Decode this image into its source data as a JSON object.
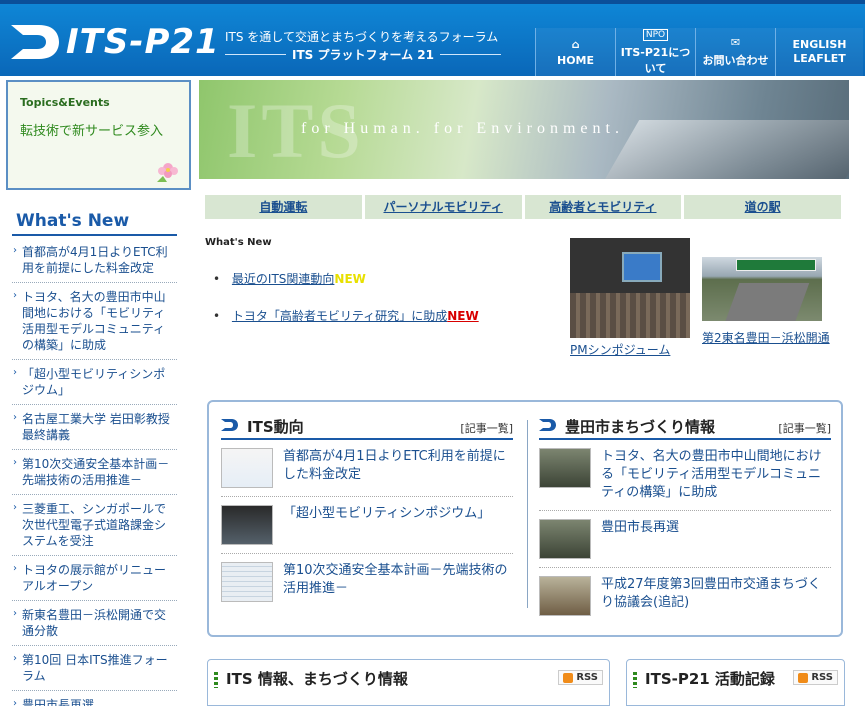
{
  "header": {
    "logo_text": "ITS-P21",
    "tagline1": "ITS を通して交通とまちづくりを考えるフォーラム",
    "tagline2": "ITS プラットフォーム 21",
    "nav": [
      {
        "icon": "home-icon",
        "label": "HOME"
      },
      {
        "icon": "npo-badge",
        "badge": "NPO",
        "label": "ITS-P21について"
      },
      {
        "icon": "mail-icon",
        "label": "お問い合わせ"
      },
      {
        "label_line1": "ENGLISH",
        "label_line2": "LEAFLET"
      }
    ]
  },
  "topics": {
    "title": "Topics&Events",
    "text": "転技術で新サービス参入"
  },
  "whats_new": {
    "title": "What's New",
    "items": [
      "首都高が4月1日よりETC利用を前提にした料金改定",
      "トヨタ、名大の豊田市中山間地における「モビリティ活用型モデルコミュニティの構築」に助成",
      "「超小型モビリティシンポジウム」",
      "名古屋工業大学 岩田彰教授最終講義",
      "第10次交通安全基本計画－先端技術の活用推進－",
      "三菱重工、シンガポールで次世代型電子式道路課金システムを受注",
      "トヨタの展示館がリニューアルオープン",
      "新東名豊田－浜松開通で交通分散",
      "第10回 日本ITS推進フォーラム",
      "豊田市長再選"
    ]
  },
  "banner": {
    "big": "ITS",
    "text": "for Human.   for Environment."
  },
  "categories": [
    "自動運転",
    "パーソナルモビリティ",
    "高齢者とモビリティ",
    "道の駅"
  ],
  "news_mini": {
    "label": "What's New",
    "items": [
      {
        "text": "最近のITS関連動向",
        "tag": "NEW"
      },
      {
        "text": "トヨタ「高齢者モビリティ研究」に助成",
        "tag": "NEW"
      }
    ],
    "photo1_caption": "PMシンポジューム",
    "photo2_caption": "第2東名豊田－浜松開通"
  },
  "its_panel": {
    "title": "ITS動向",
    "link": "[記事一覧]",
    "items": [
      "首都高が4月1日よりETC利用を前提にした料金改定",
      "「超小型モビリティシンポジウム」",
      "第10次交通安全基本計画－先端技術の活用推進－"
    ]
  },
  "toyota_panel": {
    "title": "豊田市まちづくり情報",
    "link": "[記事一覧]",
    "items": [
      "トヨタ、名大の豊田市中山間地における「モビリティ活用型モデルコミュニティの構築」に助成",
      "豊田市長再選",
      "平成27年度第3回豊田市交通まちづくり協議会(追記)"
    ]
  },
  "bottom": {
    "box1_title": "ITS 情報、まちづくり情報",
    "box2_title": "ITS-P21 活動記録",
    "rss": "RSS"
  },
  "colors": {
    "header_blue": "#0a67b8",
    "link_blue": "#1a4f8f",
    "topic_green": "#2f8a1e",
    "new_red": "#d80000",
    "new_yellow": "#e8e000"
  }
}
